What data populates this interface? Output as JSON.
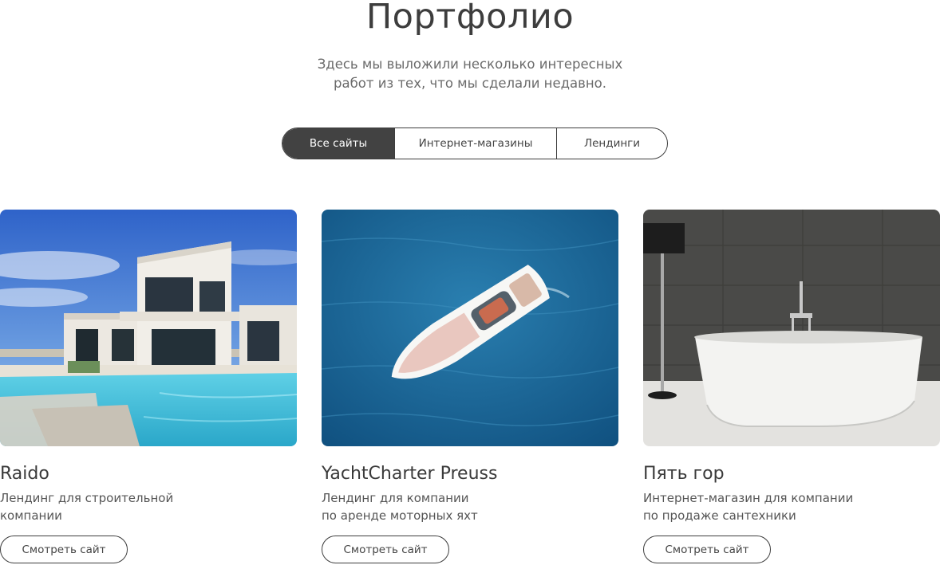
{
  "header": {
    "title": "Портфолио",
    "intro_line1": "Здесь мы выложили несколько интересных",
    "intro_line2": "работ из тех, что мы сделали недавно."
  },
  "filters": [
    {
      "label": "Все сайты",
      "active": true
    },
    {
      "label": "Интернет-магазины",
      "active": false
    },
    {
      "label": "Лендинги",
      "active": false
    }
  ],
  "projects": [
    {
      "title": "Raido",
      "desc_line1": "Лендинг для строительной",
      "desc_line2": "компании",
      "button": "Смотреть сайт",
      "image": "modern-villa-with-pool-photo"
    },
    {
      "title": "YachtCharter Preuss",
      "desc_line1": "Лендинг для компании",
      "desc_line2": "по аренде моторных яхт",
      "button": "Смотреть сайт",
      "image": "motor-yacht-aerial-photo"
    },
    {
      "title": "Пять гор",
      "desc_line1": "Интернет-магазин для компании",
      "desc_line2": "по продаже сантехники",
      "button": "Смотреть сайт",
      "image": "freestanding-bathtub-photo"
    }
  ],
  "colors": {
    "accent_dark": "#424242",
    "sea_blue": "#1a5f8c",
    "sky_blue": "#3f7fd1"
  }
}
